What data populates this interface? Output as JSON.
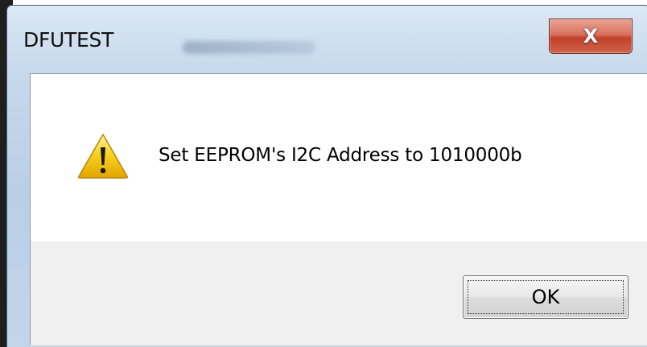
{
  "window": {
    "title": "DFUTEST",
    "close_label": "X"
  },
  "message": {
    "text": "Set EEPROM's I2C Address to 1010000b",
    "icon": "warning-icon"
  },
  "buttons": {
    "ok_label": "OK"
  },
  "colors": {
    "title_bar": "#c6d8ec",
    "close_button": "#c2412a",
    "footer": "#f0f0f0",
    "warning_fill": "#f5c400"
  }
}
